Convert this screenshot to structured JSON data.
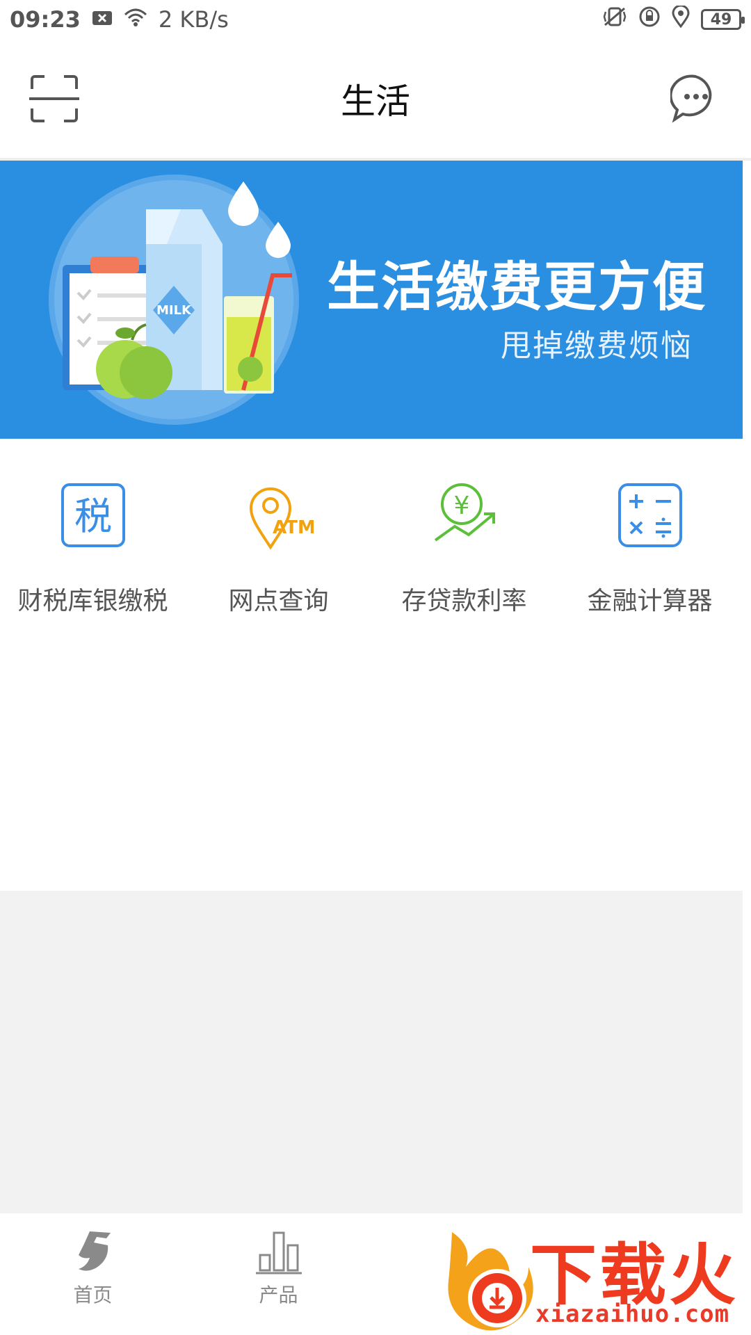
{
  "status_bar": {
    "time": "09:23",
    "network_speed": "2 KB/s",
    "battery": "49"
  },
  "header": {
    "title": "生活",
    "left_icon": "scan-icon",
    "right_icon": "message-icon"
  },
  "banner": {
    "title": "生活缴费更方便",
    "subtitle": "甩掉缴费烦恼",
    "illustration_text": "MILK",
    "background_color": "#2a8fe0"
  },
  "services": [
    {
      "label": "财税库银缴税",
      "icon": "tax-icon",
      "icon_text": "税",
      "color": "#3a8ee6"
    },
    {
      "label": "网点查询",
      "icon": "atm-location-icon",
      "icon_text": "ATM",
      "color": "#f2a20f"
    },
    {
      "label": "存贷款利率",
      "icon": "interest-rate-icon",
      "icon_text": "¥",
      "color": "#5cbf3a"
    },
    {
      "label": "金融计算器",
      "icon": "calculator-icon",
      "color": "#3a8ee6"
    }
  ],
  "bottom_nav": [
    {
      "label": "首页",
      "icon": "home-logo-icon"
    },
    {
      "label": "产品",
      "icon": "products-chart-icon"
    }
  ],
  "watermark": {
    "brand": "下载火",
    "url": "xiazaihuo.com"
  }
}
